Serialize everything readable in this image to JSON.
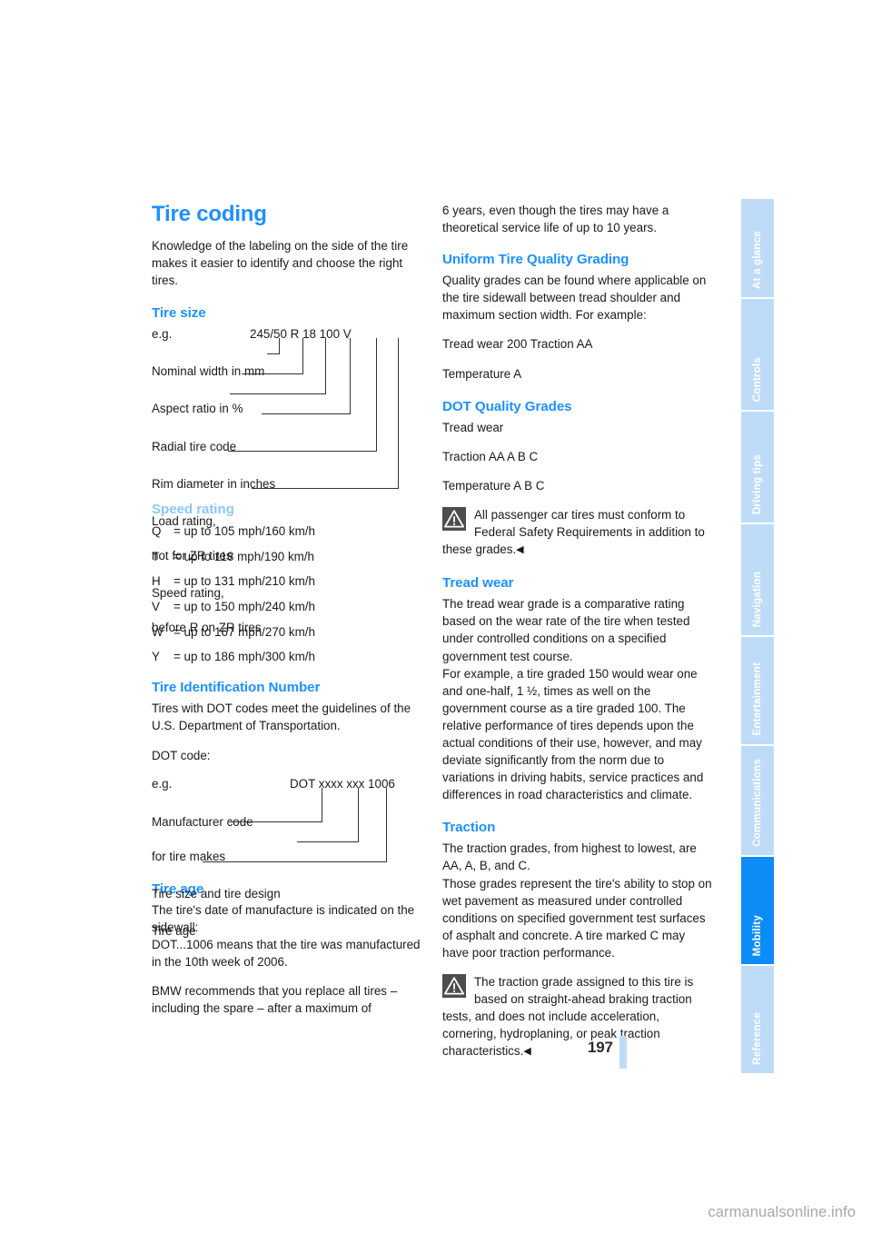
{
  "page": {
    "number": "197",
    "watermark": "carmanualsonline.info"
  },
  "left_column": {
    "title": "Tire coding",
    "intro": "Knowledge of the labeling on the side of the tire makes it easier to identify and choose the right tires.",
    "tire_size": {
      "heading": "Tire size",
      "example_label": "e.g.",
      "code_parts": [
        "245/50",
        "R",
        "18",
        "100",
        "V"
      ],
      "code_full": "245/50  R  18 100 V",
      "legend": [
        "Nominal width in mm",
        "Aspect ratio in %",
        "Radial tire code",
        "Rim diameter in inches",
        "Load rating,",
        "not for ZR tires",
        "Speed rating,",
        "before R on ZR tires"
      ]
    },
    "speed_rating": {
      "heading": "Speed rating",
      "rows": [
        {
          "code": "Q",
          "value": "= up to 105 mph/160 km/h"
        },
        {
          "code": "T",
          "value": "= up to 118 mph/190 km/h"
        },
        {
          "code": "H",
          "value": "= up to 131 mph/210 km/h"
        },
        {
          "code": "V",
          "value": "= up to 150 mph/240 km/h"
        },
        {
          "code": "W",
          "value": "= up to 167 mph/270 km/h"
        },
        {
          "code": "Y",
          "value": "= up to 186 mph/300 km/h"
        }
      ]
    },
    "tin": {
      "heading": "Tire Identification Number",
      "para": "Tires with DOT codes meet the guidelines of the U.S. Department of Transportation.",
      "dot_label": "DOT code:",
      "example_label": "e.g.",
      "code_full": "DOT xxxx xxx 1006",
      "legend": [
        "Manufacturer code",
        "for tire makes",
        "Tire size and tire design",
        "Tire age"
      ]
    },
    "tire_age": {
      "heading": "Tire age",
      "para1": "The tire's date of manufacture is indicated on the sidewall:",
      "para2": "DOT...1006 means that the tire was manufactured in the 10th week of 2006.",
      "para3": "BMW recommends that you replace all tires – including the spare – after a maximum of"
    }
  },
  "right_column": {
    "continuation": "6 years, even though the tires may have a theoretical service life of up to 10 years.",
    "utqg": {
      "heading": "Uniform Tire Quality Grading",
      "para": "Quality grades can be found where applicable on the tire sidewall between tread shoulder and maximum section width. For example:",
      "line1": "Tread wear 200 Traction AA",
      "line2": "Temperature A"
    },
    "dot_grades": {
      "heading": "DOT Quality Grades",
      "line1": "Tread wear",
      "line2": "Traction AA A B C",
      "line3": "Temperature A B C",
      "note": "All passenger car tires must conform to Federal Safety Requirements in addition to these grades.",
      "note_endmark": "◀"
    },
    "tread_wear": {
      "heading": "Tread wear",
      "para1": "The tread wear grade is a comparative rating based on the wear rate of the tire when tested under controlled conditions on a specified government test course.",
      "para2": "For example, a tire graded 150 would wear one and one-half, 1 ½, times as well on the government course as a tire graded 100. The relative performance of tires depends upon the actual conditions of their use, however, and may deviate significantly from the norm due to variations in driving habits, service practices and differences in road characteristics and climate."
    },
    "traction": {
      "heading": "Traction",
      "para1": "The traction grades, from highest to lowest, are AA, A, B, and C.",
      "para2": "Those grades represent the tire's ability to stop on wet pavement as measured under controlled conditions on specified government test surfaces of asphalt and concrete. A tire marked C may have poor traction performance.",
      "note": "The traction grade assigned to this tire is based on straight-ahead braking traction tests, and does not include acceleration, cornering, hydroplaning, or peak traction characteristics.",
      "note_endmark": "◀"
    }
  },
  "sidenav": {
    "tabs": [
      {
        "label": "At a glance",
        "active": false
      },
      {
        "label": "Controls",
        "active": false
      },
      {
        "label": "Driving tips",
        "active": false
      },
      {
        "label": "Navigation",
        "active": false
      },
      {
        "label": "Entertainment",
        "active": false
      },
      {
        "label": "Communications",
        "active": false
      },
      {
        "label": "Mobility",
        "active": true
      },
      {
        "label": "Reference",
        "active": false
      }
    ]
  },
  "colors": {
    "heading_blue": "#1e90ff",
    "tab_inactive": "#bedcf7",
    "tab_active": "#0c8cf7",
    "warn_icon_bg": "#4d4d4d"
  }
}
